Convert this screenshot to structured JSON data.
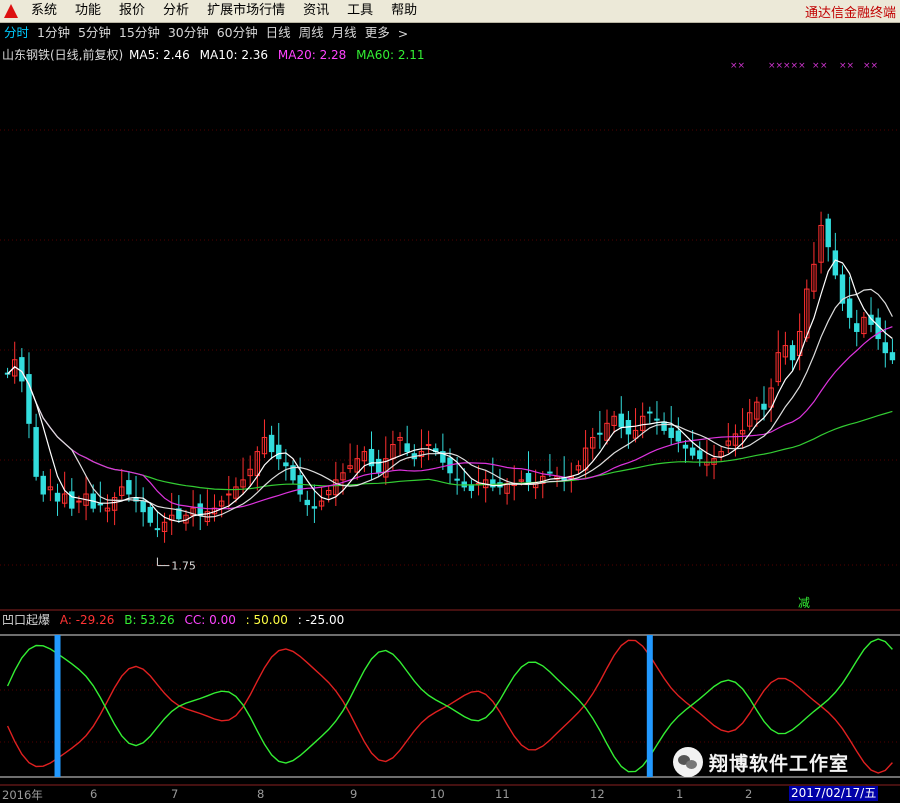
{
  "menubar": {
    "items": [
      "系统",
      "功能",
      "报价",
      "分析",
      "扩展市场行情",
      "资讯",
      "工具",
      "帮助"
    ],
    "brand": "通达信金融终端"
  },
  "periods": {
    "items": [
      "分时",
      "1分钟",
      "5分钟",
      "15分钟",
      "30分钟",
      "60分钟",
      "日线",
      "周线",
      "月线",
      "更多"
    ],
    "active": "分时",
    "chevron": ">"
  },
  "main_panel": {
    "title": "山东钢铁(日线,前复权)",
    "ma": [
      {
        "label": "MA5: 2.46",
        "color": "#ffffff"
      },
      {
        "label": "MA10: 2.36",
        "color": "#ffffff"
      },
      {
        "label": "MA20: 2.28",
        "color": "#ff44ff"
      },
      {
        "label": "MA60: 2.11",
        "color": "#33ee33"
      }
    ],
    "low_marker": "1.75",
    "signal_char": "减",
    "markers": [
      "××",
      "××",
      "×××",
      "×",
      "×",
      "××",
      "××"
    ]
  },
  "indicator_panel": {
    "name": "凹口起爆",
    "values": [
      {
        "label": "A: -29.26",
        "color": "#ff3333"
      },
      {
        "label": "B: 53.26",
        "color": "#33ee33"
      },
      {
        "label": "CC: 0.00",
        "color": "#ff44ff"
      },
      {
        "label": ": 50.00",
        "color": "#ffff44"
      },
      {
        "label": ": -25.00",
        "color": "#ffffff"
      }
    ]
  },
  "x_axis": {
    "labels": [
      "2016年",
      "6",
      "7",
      "8",
      "9",
      "10",
      "11",
      "12",
      "1",
      "2"
    ],
    "date_tag": "2017/02/17/五"
  },
  "watermark": "翔博软件工作室",
  "colors": {
    "up": "#ff3030",
    "down": "#33dddd",
    "ma5": "#ffffff",
    "ma10": "#dddddd",
    "ma20": "#dd33dd",
    "ma60": "#33cc33",
    "line_a": "#e02020",
    "line_b": "#33ee33",
    "highlight_bar": "#2299ff",
    "grid": "#550000",
    "panel_border": "#8a2020"
  },
  "chart_data": {
    "type": "candlestick",
    "title": "山东钢铁(日线,前复权)",
    "period": "日线",
    "adjustment": "前复权",
    "close": [
      2.24,
      2.28,
      2.22,
      2.1,
      1.95,
      1.9,
      1.92,
      1.88,
      1.9,
      1.86,
      1.88,
      1.9,
      1.86,
      1.87,
      1.86,
      1.89,
      1.92,
      1.9,
      1.88,
      1.85,
      1.82,
      1.8,
      1.82,
      1.84,
      1.83,
      1.84,
      1.86,
      1.84,
      1.85,
      1.86,
      1.88,
      1.9,
      1.92,
      1.94,
      1.97,
      2.02,
      2.06,
      2.02,
      2.0,
      1.98,
      1.94,
      1.9,
      1.87,
      1.86,
      1.88,
      1.91,
      1.94,
      1.96,
      1.98,
      2.0,
      2.02,
      1.98,
      1.96,
      2.0,
      2.04,
      2.06,
      2.02,
      2.0,
      2.02,
      2.04,
      2.02,
      1.99,
      1.96,
      1.94,
      1.92,
      1.91,
      1.93,
      1.94,
      1.92,
      1.92,
      1.93,
      1.93,
      1.94,
      1.93,
      1.93,
      1.95,
      1.96,
      1.95,
      1.94,
      1.95,
      1.98,
      2.03,
      2.06,
      2.07,
      2.1,
      2.12,
      2.09,
      2.07,
      2.08,
      2.12,
      2.13,
      2.11,
      2.08,
      2.06,
      2.05,
      2.03,
      2.01,
      2.0,
      1.99,
      2.0,
      2.02,
      2.05,
      2.07,
      2.08,
      2.13,
      2.16,
      2.14,
      2.2,
      2.3,
      2.32,
      2.28,
      2.36,
      2.48,
      2.55,
      2.66,
      2.6,
      2.52,
      2.44,
      2.4,
      2.36,
      2.4,
      2.38,
      2.34,
      2.3,
      2.28
    ],
    "low_label": 1.75,
    "ma_last": {
      "MA5": 2.46,
      "MA10": 2.36,
      "MA20": 2.28,
      "MA60": 2.11
    },
    "indicator": {
      "name": "凹口起爆",
      "A": -29.26,
      "B": 53.26,
      "CC": 0.0,
      "levels": [
        50.0,
        -25.0
      ],
      "highlight_bars": [
        3,
        86
      ]
    }
  }
}
